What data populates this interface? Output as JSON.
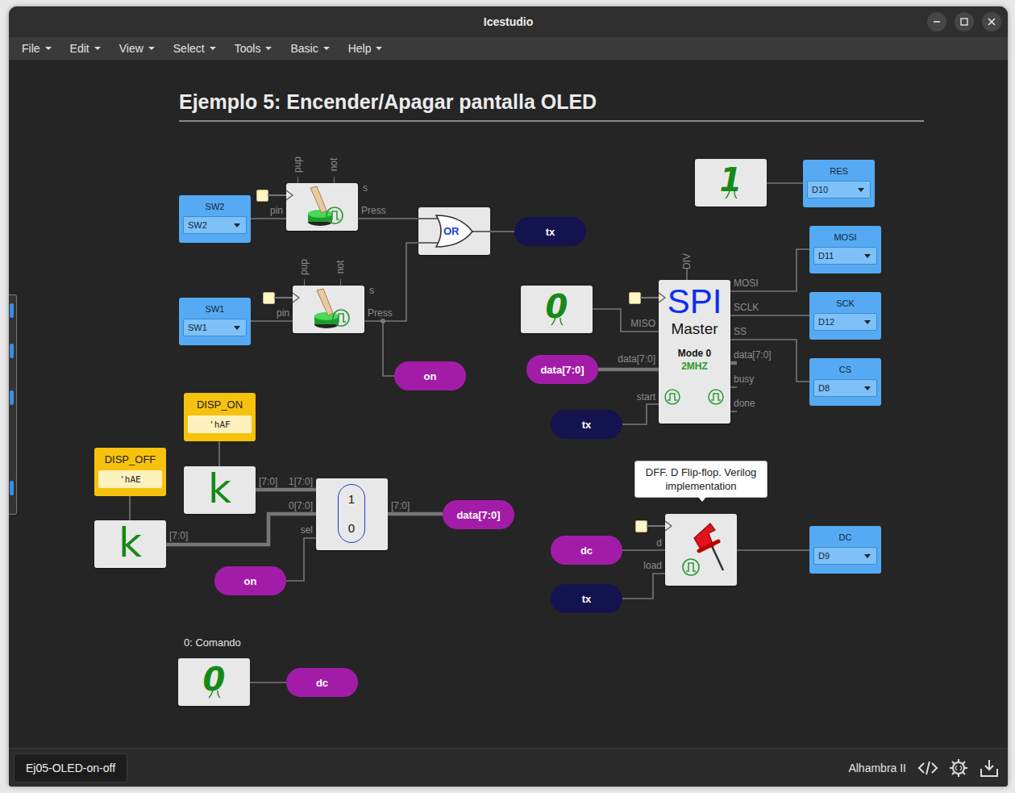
{
  "window": {
    "title": "Icestudio"
  },
  "menu": [
    "File",
    "Edit",
    "View",
    "Select",
    "Tools",
    "Basic",
    "Help"
  ],
  "canvas": {
    "title": "Ejemplo 5: Encender/Apagar pantalla OLED"
  },
  "inputs": [
    {
      "label": "SW2",
      "value": "SW2"
    },
    {
      "label": "SW1",
      "value": "SW1"
    },
    {
      "label": "RES",
      "value": "D10"
    },
    {
      "label": "MOSI",
      "value": "D11"
    },
    {
      "label": "SCK",
      "value": "D12"
    },
    {
      "label": "CS",
      "value": "D8"
    },
    {
      "label": "DC",
      "value": "D9"
    }
  ],
  "buttons": [
    {
      "top": [
        "pup",
        "not"
      ],
      "side": "s",
      "in": "pin",
      "out": "Press"
    },
    {
      "top": [
        "pup",
        "not"
      ],
      "side": "s",
      "in": "pin",
      "out": "Press"
    }
  ],
  "gate": {
    "text": "OR"
  },
  "labels": [
    {
      "text": "tx",
      "color": "#13144f"
    },
    {
      "text": "on",
      "color": "#a31ca8"
    },
    {
      "text": "tx",
      "color": "#13144f"
    },
    {
      "text": "data[7:0]",
      "color": "#a31ca8"
    },
    {
      "text": "on",
      "color": "#a31ca8"
    },
    {
      "text": "data[7:0]",
      "color": "#a31ca8"
    },
    {
      "text": "dc",
      "color": "#a31ca8"
    },
    {
      "text": "tx",
      "color": "#13144f"
    },
    {
      "text": "dc",
      "color": "#a31ca8"
    }
  ],
  "bits": [
    {
      "value": "1",
      "note": ""
    },
    {
      "value": "0",
      "note": ""
    },
    {
      "value": "0",
      "note": "0: Comando"
    }
  ],
  "constants": [
    {
      "name": "DISP_ON",
      "value": "'hAF",
      "symbol": "k",
      "out": "[7:0]"
    },
    {
      "name": "DISP_OFF",
      "value": "'hAE",
      "symbol": "k",
      "out": "[7:0]"
    }
  ],
  "mux": {
    "inputs": [
      "1[7:0]",
      "0[7:0]"
    ],
    "sel": "sel",
    "out": "[7:0]",
    "options": [
      "1",
      "0"
    ]
  },
  "spi": {
    "title": "SPI",
    "subtitle": "Master",
    "mode": "Mode 0",
    "speed": "2MHZ",
    "div": "DIV",
    "inputs": [
      "MISO",
      "data[7:0]",
      "start"
    ],
    "outputs": [
      "MOSI",
      "SCLK",
      "SS",
      "data[7:0]",
      "busy",
      "done"
    ]
  },
  "dff": {
    "tooltip": "DFF. D Flip-flop. Verilog implementation",
    "inputs": [
      "d",
      "load"
    ]
  },
  "status_bar": {
    "project": "Ej05-OLED-on-off",
    "board": "Alhambra II"
  }
}
